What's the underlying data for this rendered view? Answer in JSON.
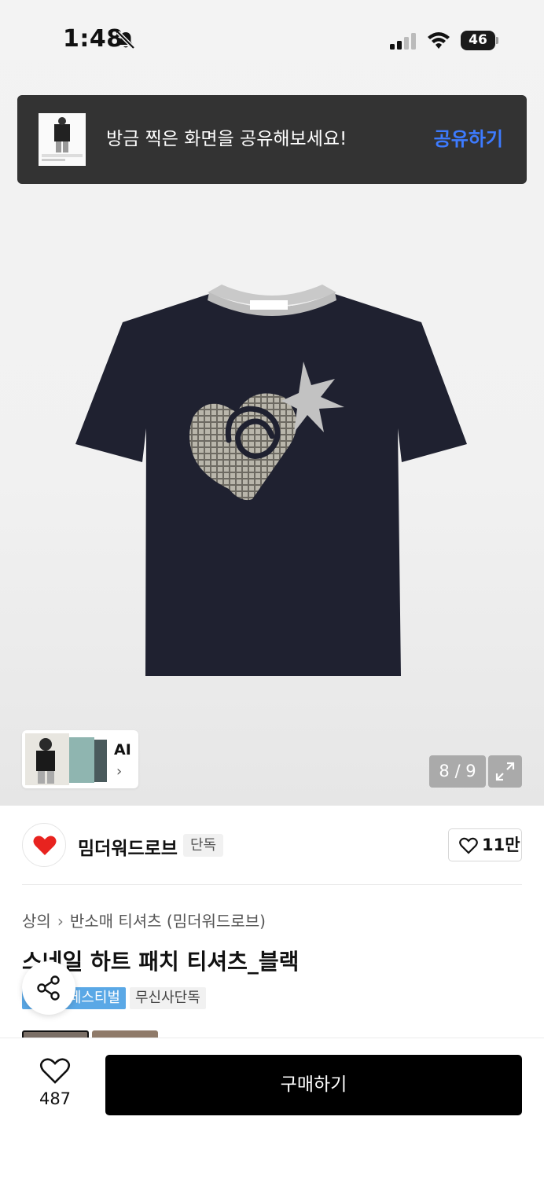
{
  "status_bar": {
    "time": "1:48",
    "battery": "46"
  },
  "share_banner": {
    "text": "방금 찍은 화면을 공유해보세요!",
    "action_label": "공유하기"
  },
  "gallery": {
    "ai_label": "AI",
    "ai_chevron": "›",
    "page_counter": "8 / 9"
  },
  "brand": {
    "name": "밈더워드로브",
    "badge": "단독",
    "like_count": "11만"
  },
  "breadcrumb": {
    "category": "상의",
    "separator": "›",
    "subcategory": "반소매 티셔츠 (밈더워드로브)"
  },
  "product": {
    "title": "스네일 하트 패치 티셔츠_블랙",
    "tags": {
      "festival": "페스티벌",
      "exclusive": "무신사단독"
    }
  },
  "bottom_bar": {
    "wish_count": "487",
    "buy_label": "구매하기"
  },
  "colors": {
    "banner_bg": "#333333",
    "banner_link": "#3d7bff",
    "festival_tag": "#5aa8e6",
    "buy_button": "#000000",
    "shirt": "#1f2130"
  },
  "icons": [
    "bell-slash-icon",
    "signal-icon",
    "wifi-icon",
    "battery-icon",
    "expand-icon",
    "heart-icon",
    "share-icon",
    "heart-outline-icon"
  ]
}
